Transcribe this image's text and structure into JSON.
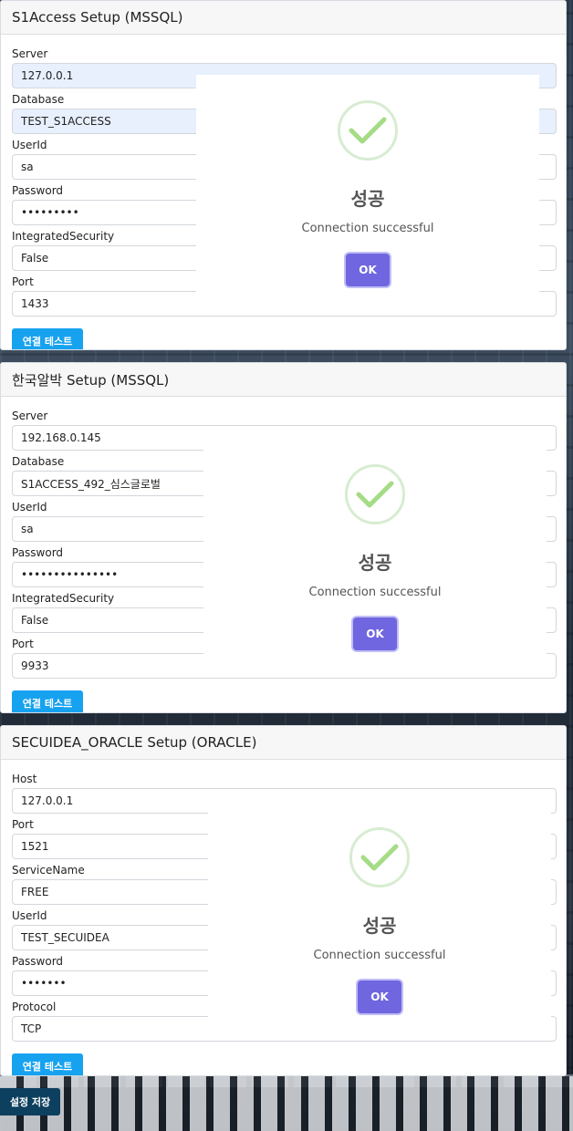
{
  "sections": [
    {
      "title": "S1Access Setup (MSSQL)",
      "fields": [
        {
          "label": "Server",
          "value": "127.0.0.1"
        },
        {
          "label": "Database",
          "value": "TEST_S1ACCESS"
        },
        {
          "label": "UserId",
          "value": "sa"
        },
        {
          "label": "Password",
          "value": "•••••••••"
        },
        {
          "label": "IntegratedSecurity",
          "value": "False"
        },
        {
          "label": "Port",
          "value": "1433"
        }
      ],
      "test_button": "연결 테스트",
      "dialog": {
        "title": "성공",
        "message": "Connection successful",
        "ok": "OK"
      }
    },
    {
      "title": "한국알박 Setup (MSSQL)",
      "fields": [
        {
          "label": "Server",
          "value": "192.168.0.145"
        },
        {
          "label": "Database",
          "value": "S1ACCESS_492_심스글로벌"
        },
        {
          "label": "UserId",
          "value": "sa"
        },
        {
          "label": "Password",
          "value": "•••••••••••••••"
        },
        {
          "label": "IntegratedSecurity",
          "value": "False"
        },
        {
          "label": "Port",
          "value": "9933"
        }
      ],
      "test_button": "연결 테스트",
      "dialog": {
        "title": "성공",
        "message": "Connection successful",
        "ok": "OK"
      }
    },
    {
      "title": "SECUIDEA_ORACLE Setup (ORACLE)",
      "fields": [
        {
          "label": "Host",
          "value": "127.0.0.1"
        },
        {
          "label": "Port",
          "value": "1521"
        },
        {
          "label": "ServiceName",
          "value": "FREE"
        },
        {
          "label": "UserId",
          "value": "TEST_SECUIDEA"
        },
        {
          "label": "Password",
          "value": "•••••••"
        },
        {
          "label": "Protocol",
          "value": "TCP"
        }
      ],
      "test_button": "연결 테스트",
      "dialog": {
        "title": "성공",
        "message": "Connection successful",
        "ok": "OK"
      }
    }
  ],
  "save_button": "설정 저장",
  "icons": {
    "success": "checkmark-icon"
  },
  "colors": {
    "primary_button": "#17a2f0",
    "dialog_ok": "#7066e0",
    "check": "#a5dc86",
    "save_button": "#0d3f5e"
  }
}
